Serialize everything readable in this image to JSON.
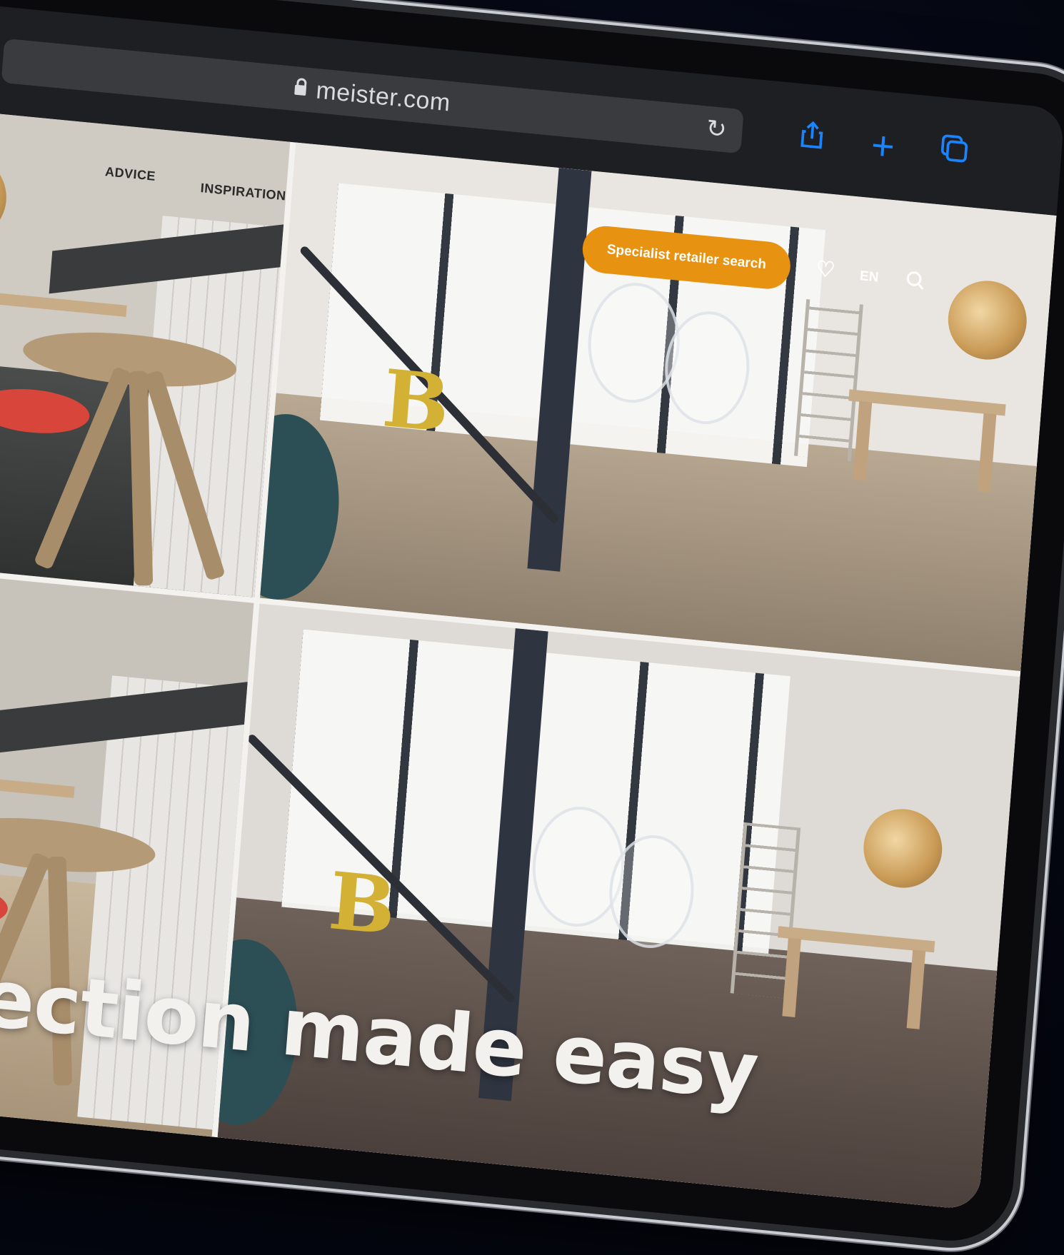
{
  "browser": {
    "url": "meister.com",
    "icons": [
      "lock-icon",
      "reload-icon",
      "share-icon",
      "new-tab-icon",
      "tabs-icon"
    ],
    "accent_color": "#1a84ff"
  },
  "site": {
    "nav": {
      "advice": "ADVICE",
      "inspiration": "INSPIRATION"
    },
    "retailer_button": "Specialist retailer search",
    "retailer_button_color": "#e89211",
    "language": "EN",
    "headline": "ection made easy",
    "tiles": [
      {
        "name": "dark-floor-room"
      },
      {
        "name": "light-oak-floor-room"
      },
      {
        "name": "wood-floor-room"
      },
      {
        "name": "dark-brown-floor-room"
      }
    ]
  }
}
